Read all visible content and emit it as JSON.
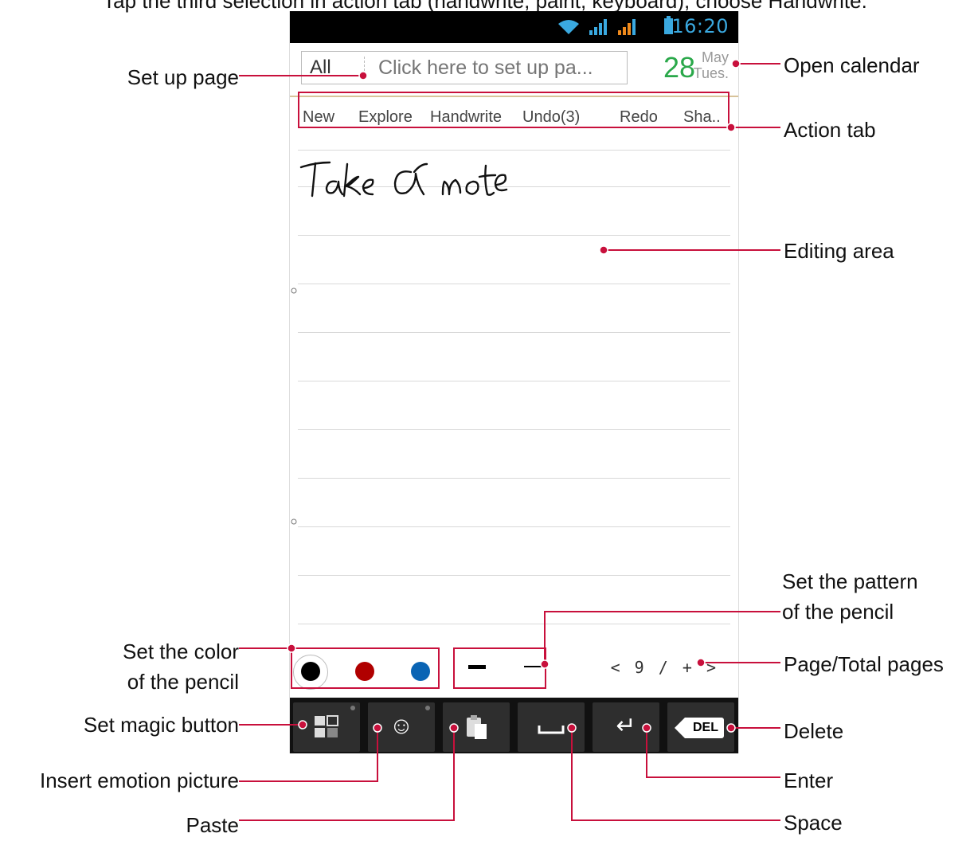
{
  "caption": "Tap the third selection in action tab (handwrite, paint, keyboard), choose Handwrite.",
  "status_bar": {
    "time": "16:20",
    "icons": [
      "wifi-icon",
      "signal-icon",
      "signal-roaming-icon",
      "battery-icon"
    ]
  },
  "header": {
    "page_filter": "All",
    "page_placeholder": "Click here to set up pa...",
    "calendar_day": "28",
    "calendar_month": "May",
    "calendar_weekday": "Tues."
  },
  "action_tab": {
    "items": [
      "New",
      "Explore",
      "Handwrite",
      "Undo(3)",
      "Redo",
      "Sha.."
    ]
  },
  "note": {
    "handwritten_text": "Take a note"
  },
  "pencil": {
    "colors": [
      "#000000",
      "#b00000",
      "#0a64b4"
    ],
    "selected_color_index": 0,
    "patterns": [
      "thick-line",
      "thin-line"
    ]
  },
  "pager": {
    "prev": "<",
    "current": "9",
    "sep": "/",
    "add": "+",
    "next": ">"
  },
  "keys": {
    "magic": "magic-grid-icon",
    "emotion": "☺",
    "paste": "paste-icon",
    "space": "␣",
    "enter": "↵",
    "delete": "DEL"
  },
  "annotations": {
    "set_up_page": "Set up page",
    "open_calendar": "Open calendar",
    "action_tab": "Action tab",
    "editing_area": "Editing area",
    "set_pattern_line1": "Set the pattern",
    "set_pattern_line2": "of the pencil",
    "set_color_line1": "Set the color",
    "set_color_line2": "of the pencil",
    "page_total": "Page/Total pages",
    "set_magic": "Set magic button",
    "delete": "Delete",
    "insert_emotion": "Insert emotion picture",
    "enter": "Enter",
    "paste": "Paste",
    "space": "Space"
  },
  "accent_color": "#c8103c"
}
